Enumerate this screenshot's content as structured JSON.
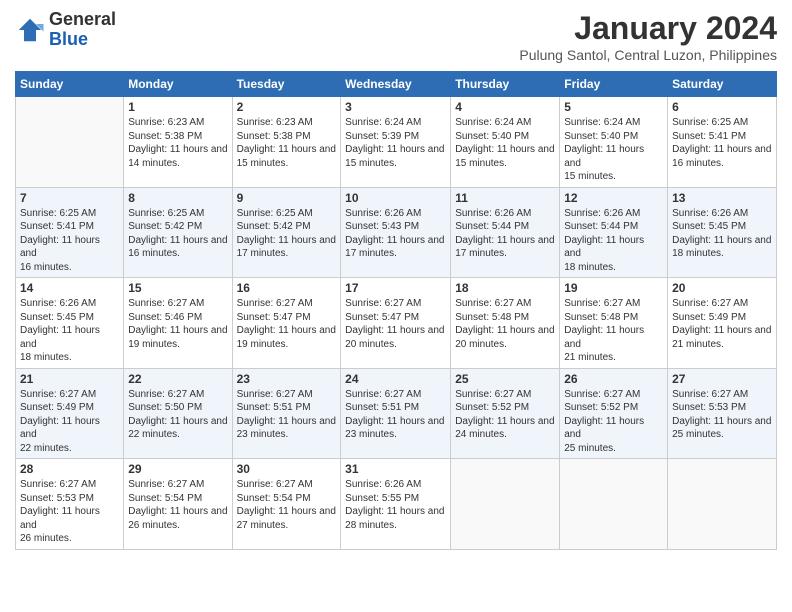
{
  "logo": {
    "general": "General",
    "blue": "Blue"
  },
  "header": {
    "month_title": "January 2024",
    "location": "Pulung Santol, Central Luzon, Philippines"
  },
  "days_of_week": [
    "Sunday",
    "Monday",
    "Tuesday",
    "Wednesday",
    "Thursday",
    "Friday",
    "Saturday"
  ],
  "weeks": [
    [
      {
        "day": "",
        "empty": true
      },
      {
        "day": "1",
        "sunrise": "6:23 AM",
        "sunset": "5:38 PM",
        "daylight": "11 hours and 14 minutes."
      },
      {
        "day": "2",
        "sunrise": "6:23 AM",
        "sunset": "5:38 PM",
        "daylight": "11 hours and 15 minutes."
      },
      {
        "day": "3",
        "sunrise": "6:24 AM",
        "sunset": "5:39 PM",
        "daylight": "11 hours and 15 minutes."
      },
      {
        "day": "4",
        "sunrise": "6:24 AM",
        "sunset": "5:40 PM",
        "daylight": "11 hours and 15 minutes."
      },
      {
        "day": "5",
        "sunrise": "6:24 AM",
        "sunset": "5:40 PM",
        "daylight": "11 hours and 15 minutes."
      },
      {
        "day": "6",
        "sunrise": "6:25 AM",
        "sunset": "5:41 PM",
        "daylight": "11 hours and 16 minutes."
      }
    ],
    [
      {
        "day": "7",
        "sunrise": "6:25 AM",
        "sunset": "5:41 PM",
        "daylight": "11 hours and 16 minutes."
      },
      {
        "day": "8",
        "sunrise": "6:25 AM",
        "sunset": "5:42 PM",
        "daylight": "11 hours and 16 minutes."
      },
      {
        "day": "9",
        "sunrise": "6:25 AM",
        "sunset": "5:42 PM",
        "daylight": "11 hours and 17 minutes."
      },
      {
        "day": "10",
        "sunrise": "6:26 AM",
        "sunset": "5:43 PM",
        "daylight": "11 hours and 17 minutes."
      },
      {
        "day": "11",
        "sunrise": "6:26 AM",
        "sunset": "5:44 PM",
        "daylight": "11 hours and 17 minutes."
      },
      {
        "day": "12",
        "sunrise": "6:26 AM",
        "sunset": "5:44 PM",
        "daylight": "11 hours and 18 minutes."
      },
      {
        "day": "13",
        "sunrise": "6:26 AM",
        "sunset": "5:45 PM",
        "daylight": "11 hours and 18 minutes."
      }
    ],
    [
      {
        "day": "14",
        "sunrise": "6:26 AM",
        "sunset": "5:45 PM",
        "daylight": "11 hours and 18 minutes."
      },
      {
        "day": "15",
        "sunrise": "6:27 AM",
        "sunset": "5:46 PM",
        "daylight": "11 hours and 19 minutes."
      },
      {
        "day": "16",
        "sunrise": "6:27 AM",
        "sunset": "5:47 PM",
        "daylight": "11 hours and 19 minutes."
      },
      {
        "day": "17",
        "sunrise": "6:27 AM",
        "sunset": "5:47 PM",
        "daylight": "11 hours and 20 minutes."
      },
      {
        "day": "18",
        "sunrise": "6:27 AM",
        "sunset": "5:48 PM",
        "daylight": "11 hours and 20 minutes."
      },
      {
        "day": "19",
        "sunrise": "6:27 AM",
        "sunset": "5:48 PM",
        "daylight": "11 hours and 21 minutes."
      },
      {
        "day": "20",
        "sunrise": "6:27 AM",
        "sunset": "5:49 PM",
        "daylight": "11 hours and 21 minutes."
      }
    ],
    [
      {
        "day": "21",
        "sunrise": "6:27 AM",
        "sunset": "5:49 PM",
        "daylight": "11 hours and 22 minutes."
      },
      {
        "day": "22",
        "sunrise": "6:27 AM",
        "sunset": "5:50 PM",
        "daylight": "11 hours and 22 minutes."
      },
      {
        "day": "23",
        "sunrise": "6:27 AM",
        "sunset": "5:51 PM",
        "daylight": "11 hours and 23 minutes."
      },
      {
        "day": "24",
        "sunrise": "6:27 AM",
        "sunset": "5:51 PM",
        "daylight": "11 hours and 23 minutes."
      },
      {
        "day": "25",
        "sunrise": "6:27 AM",
        "sunset": "5:52 PM",
        "daylight": "11 hours and 24 minutes."
      },
      {
        "day": "26",
        "sunrise": "6:27 AM",
        "sunset": "5:52 PM",
        "daylight": "11 hours and 25 minutes."
      },
      {
        "day": "27",
        "sunrise": "6:27 AM",
        "sunset": "5:53 PM",
        "daylight": "11 hours and 25 minutes."
      }
    ],
    [
      {
        "day": "28",
        "sunrise": "6:27 AM",
        "sunset": "5:53 PM",
        "daylight": "11 hours and 26 minutes."
      },
      {
        "day": "29",
        "sunrise": "6:27 AM",
        "sunset": "5:54 PM",
        "daylight": "11 hours and 26 minutes."
      },
      {
        "day": "30",
        "sunrise": "6:27 AM",
        "sunset": "5:54 PM",
        "daylight": "11 hours and 27 minutes."
      },
      {
        "day": "31",
        "sunrise": "6:26 AM",
        "sunset": "5:55 PM",
        "daylight": "11 hours and 28 minutes."
      },
      {
        "day": "",
        "empty": true
      },
      {
        "day": "",
        "empty": true
      },
      {
        "day": "",
        "empty": true
      }
    ]
  ],
  "labels": {
    "sunrise": "Sunrise:",
    "sunset": "Sunset:",
    "daylight": "Daylight:"
  }
}
